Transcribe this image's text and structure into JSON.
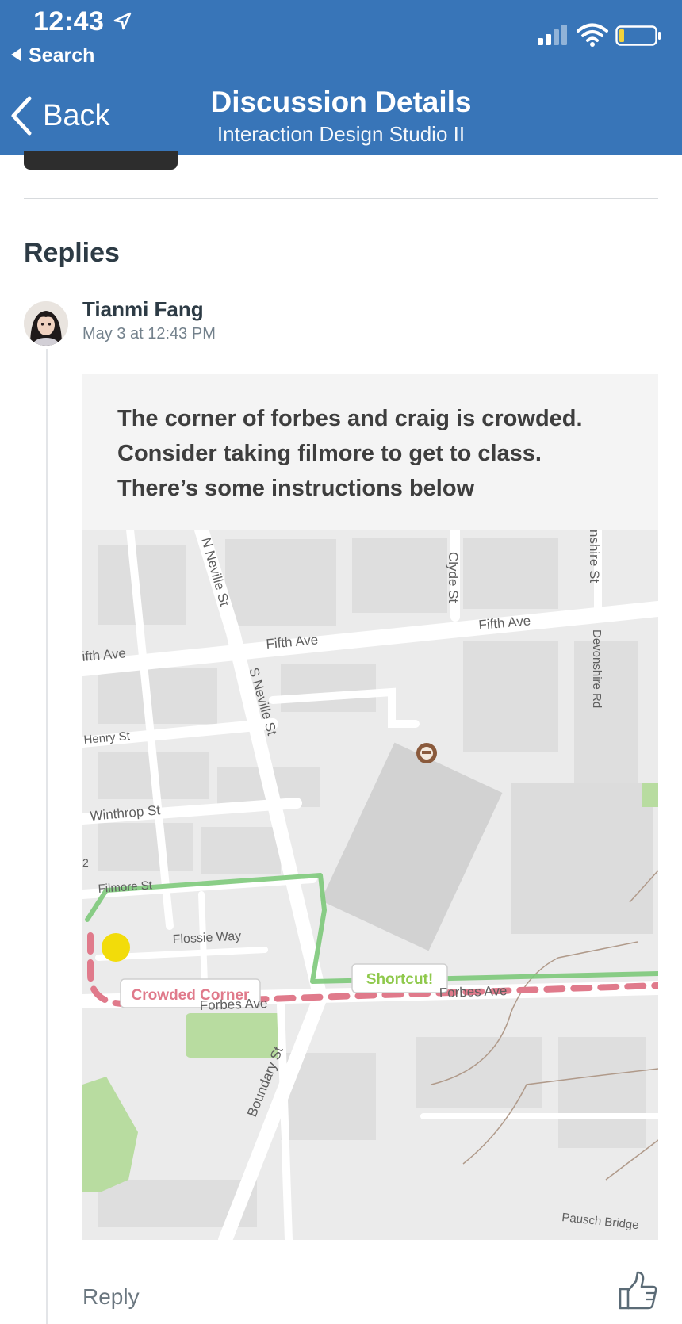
{
  "status_bar": {
    "time": "12:43",
    "back_app_label": "Search",
    "icons": [
      "location-arrow-icon",
      "signal-icon",
      "wifi-icon",
      "battery-icon"
    ]
  },
  "nav": {
    "back_label": "Back",
    "title": "Discussion Details",
    "subtitle": "Interaction Design Studio II"
  },
  "replies": {
    "heading": "Replies",
    "items": [
      {
        "author": "Tianmi Fang",
        "timestamp": "May 3 at 12:43 PM",
        "image": {
          "text_lines": [
            "The corner of forbes and craig is crowded.",
            "Consider taking filmore to get to class.",
            "There’s some instructions below"
          ],
          "map_labels": {
            "n_neville": "N Neville St",
            "clyde": "Clyde St",
            "devonshire_top": "nshire St",
            "fifth_left": "ifth Ave",
            "fifth_mid": "Fifth Ave",
            "fifth_right": "Fifth Ave",
            "s_neville": "S Neville St",
            "devonshire_rd": "Devonshire Rd",
            "henry": "Henry St",
            "winthrop": "Winthrop St",
            "filmore": "Filmore St",
            "flossie": "Flossie Way",
            "forbes_left": "Forbes Ave",
            "forbes_right": "Forbes Ave",
            "boundary": "Boundary St",
            "pausch": "Pausch Bridge",
            "edge_char": "2"
          },
          "callouts": {
            "crowded": "Crowded Corner",
            "shortcut": "Shortcut!"
          },
          "colors": {
            "crowded_route": "#e07a8b",
            "shortcut_route": "#7dc97a",
            "crowded_marker": "#f2dc0a"
          }
        },
        "reply_label": "Reply",
        "like_icon": "thumbs-up-icon"
      }
    ]
  }
}
